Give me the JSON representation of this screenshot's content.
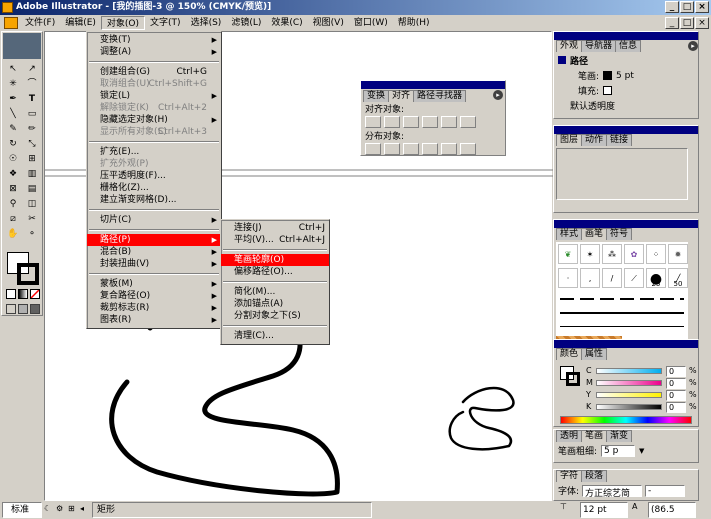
{
  "window": {
    "title": "Adobe Illustrator - [我的插图-3 @ 150% (CMYK/预览)]",
    "min_icon": "_",
    "max_icon": "□",
    "close_icon": "×"
  },
  "menubar": {
    "items": [
      "文件(F)",
      "编辑(E)",
      "对象(O)",
      "文字(T)",
      "选择(S)",
      "滤镜(L)",
      "效果(C)",
      "视图(V)",
      "窗口(W)",
      "帮助(H)"
    ]
  },
  "object_menu": {
    "items": [
      {
        "label": "变换(T)",
        "shortcut": "",
        "arrow": true,
        "disabled": false
      },
      {
        "label": "调整(A)",
        "shortcut": "",
        "arrow": true,
        "disabled": false
      },
      {
        "sep": true
      },
      {
        "label": "创建组合(G)",
        "shortcut": "Ctrl+G",
        "arrow": false,
        "disabled": false
      },
      {
        "label": "取消组合(U)",
        "shortcut": "Ctrl+Shift+G",
        "arrow": false,
        "disabled": true
      },
      {
        "label": "锁定(L)",
        "shortcut": "",
        "arrow": true,
        "disabled": false
      },
      {
        "label": "解除锁定(K)",
        "shortcut": "Ctrl+Alt+2",
        "arrow": false,
        "disabled": true
      },
      {
        "label": "隐藏选定对象(H)",
        "shortcut": "",
        "arrow": true,
        "disabled": false
      },
      {
        "label": "显示所有对象(S)",
        "shortcut": "Ctrl+Alt+3",
        "arrow": false,
        "disabled": true
      },
      {
        "sep": true
      },
      {
        "label": "扩充(E)...",
        "shortcut": "",
        "arrow": false,
        "disabled": false
      },
      {
        "label": "扩充外观(P)",
        "shortcut": "",
        "arrow": false,
        "disabled": true
      },
      {
        "label": "压平透明度(F)...",
        "shortcut": "",
        "arrow": false,
        "disabled": false
      },
      {
        "label": "栅格化(Z)...",
        "shortcut": "",
        "arrow": false,
        "disabled": false
      },
      {
        "label": "建立渐变网格(D)...",
        "shortcut": "",
        "arrow": false,
        "disabled": false
      },
      {
        "sep": true
      },
      {
        "label": "切片(C)",
        "shortcut": "",
        "arrow": true,
        "disabled": false
      },
      {
        "sep": true
      },
      {
        "label": "路径(P)",
        "shortcut": "",
        "arrow": true,
        "disabled": false,
        "highlight": true
      },
      {
        "label": "混合(B)",
        "shortcut": "",
        "arrow": true,
        "disabled": false
      },
      {
        "label": "封装扭曲(V)",
        "shortcut": "",
        "arrow": true,
        "disabled": false
      },
      {
        "sep": true
      },
      {
        "label": "蒙板(M)",
        "shortcut": "",
        "arrow": true,
        "disabled": false
      },
      {
        "label": "复合路径(O)",
        "shortcut": "",
        "arrow": true,
        "disabled": false
      },
      {
        "label": "裁剪标志(R)",
        "shortcut": "",
        "arrow": true,
        "disabled": false
      },
      {
        "label": "图表(R)",
        "shortcut": "",
        "arrow": true,
        "disabled": false
      }
    ]
  },
  "path_submenu": {
    "items": [
      {
        "label": "连接(J)",
        "shortcut": "Ctrl+J"
      },
      {
        "label": "平均(V)...",
        "shortcut": "Ctrl+Alt+J"
      },
      {
        "sep": true
      },
      {
        "label": "笔画轮廓(O)",
        "shortcut": "",
        "highlight": true
      },
      {
        "label": "偏移路径(O)...",
        "shortcut": ""
      },
      {
        "sep": true
      },
      {
        "label": "简化(M)...",
        "shortcut": ""
      },
      {
        "label": "添加锚点(A)",
        "shortcut": ""
      },
      {
        "label": "分割对象之下(S)",
        "shortcut": ""
      },
      {
        "sep": true
      },
      {
        "label": "清理(C)...",
        "shortcut": ""
      }
    ]
  },
  "align_panel": {
    "tabs": [
      "变换",
      "对齐",
      "路径寻找器"
    ],
    "align_label": "对齐对象:",
    "distribute_label": "分布对象:"
  },
  "appearance_panel": {
    "tabs": [
      "外观",
      "导航器",
      "信息"
    ],
    "object_label": "路径",
    "stroke_label": "笔画:",
    "stroke_value": "5 pt",
    "fill_label": "填充:",
    "opacity_label": "默认透明度"
  },
  "layers_panel": {
    "tabs": [
      "图层",
      "动作",
      "链接"
    ]
  },
  "brushes_panel": {
    "tabs": [
      "样式",
      "画笔",
      "符号"
    ],
    "size_labels": [
      "25",
      "50"
    ]
  },
  "color_panel": {
    "tabs": [
      "颜色",
      "属性"
    ],
    "channels": [
      {
        "label": "C",
        "value": "0",
        "unit": "%"
      },
      {
        "label": "M",
        "value": "0",
        "unit": "%"
      },
      {
        "label": "Y",
        "value": "0",
        "unit": "%"
      },
      {
        "label": "K",
        "value": "0",
        "unit": "%"
      }
    ]
  },
  "stroke_panel": {
    "tabs": [
      "透明",
      "笔画",
      "渐变"
    ],
    "weight_label": "笔画粗细:",
    "weight_value": "5 p"
  },
  "char_panel": {
    "tabs": [
      "字符",
      "段落"
    ],
    "font_label": "字体:",
    "font_value": "方正综艺简",
    "style_value": "-",
    "size_value": "12 pt",
    "leading_value": "(86.5"
  },
  "statusbar": {
    "zoom": "标准",
    "tool_label": "矩形"
  },
  "colors": {
    "highlight": "#ff0000",
    "panel_header": "#000080"
  }
}
